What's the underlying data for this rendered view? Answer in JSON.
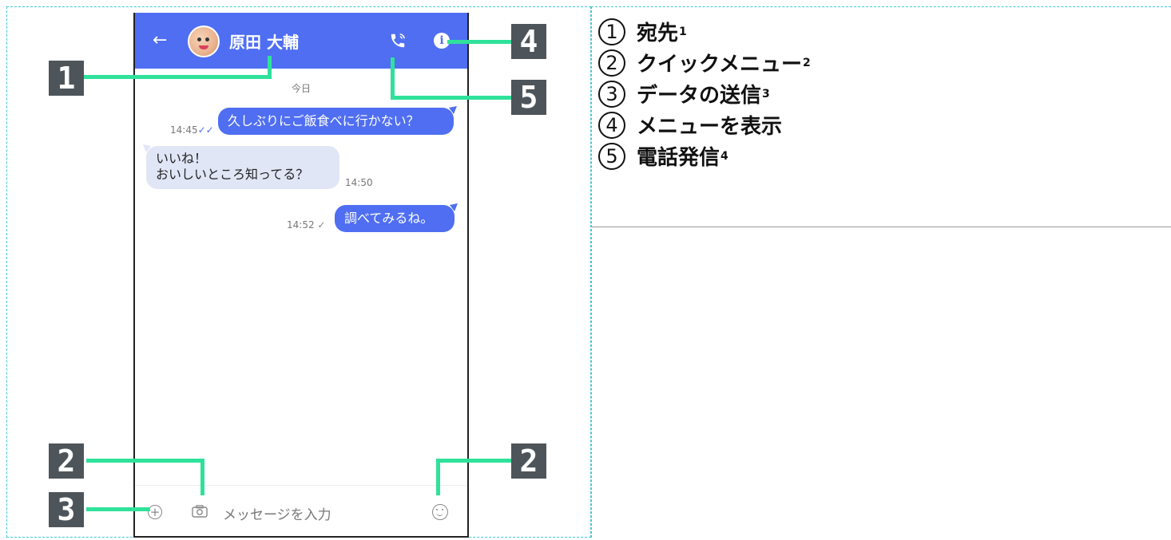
{
  "chat": {
    "contact_name": "原田 大輔",
    "date_label": "今日",
    "input_placeholder": "メッセージを入力",
    "messages": [
      {
        "text": "久しぶりにご飯食べに行かない？",
        "time": "14:45",
        "direction": "out",
        "status": "read"
      },
      {
        "line1": "いいね！",
        "line2": "おいしいところ知ってる？",
        "time": "14:50",
        "direction": "in"
      },
      {
        "text": "調べてみるね。",
        "time": "14:52",
        "direction": "out",
        "status": "sent"
      }
    ],
    "accent_color": "#4f6ef2"
  },
  "callouts": {
    "tag1": "1",
    "tag2_left": "2",
    "tag2_right": "2",
    "tag3": "3",
    "tag4": "4",
    "tag5": "5"
  },
  "legend": [
    {
      "num": "1",
      "label": "宛先",
      "note": "1"
    },
    {
      "num": "2",
      "label": "クイックメニュー",
      "note": "2"
    },
    {
      "num": "3",
      "label": "データの送信",
      "note": "3"
    },
    {
      "num": "4",
      "label": "メニューを表示",
      "note": ""
    },
    {
      "num": "5",
      "label": "電話発信",
      "note": "4"
    }
  ]
}
